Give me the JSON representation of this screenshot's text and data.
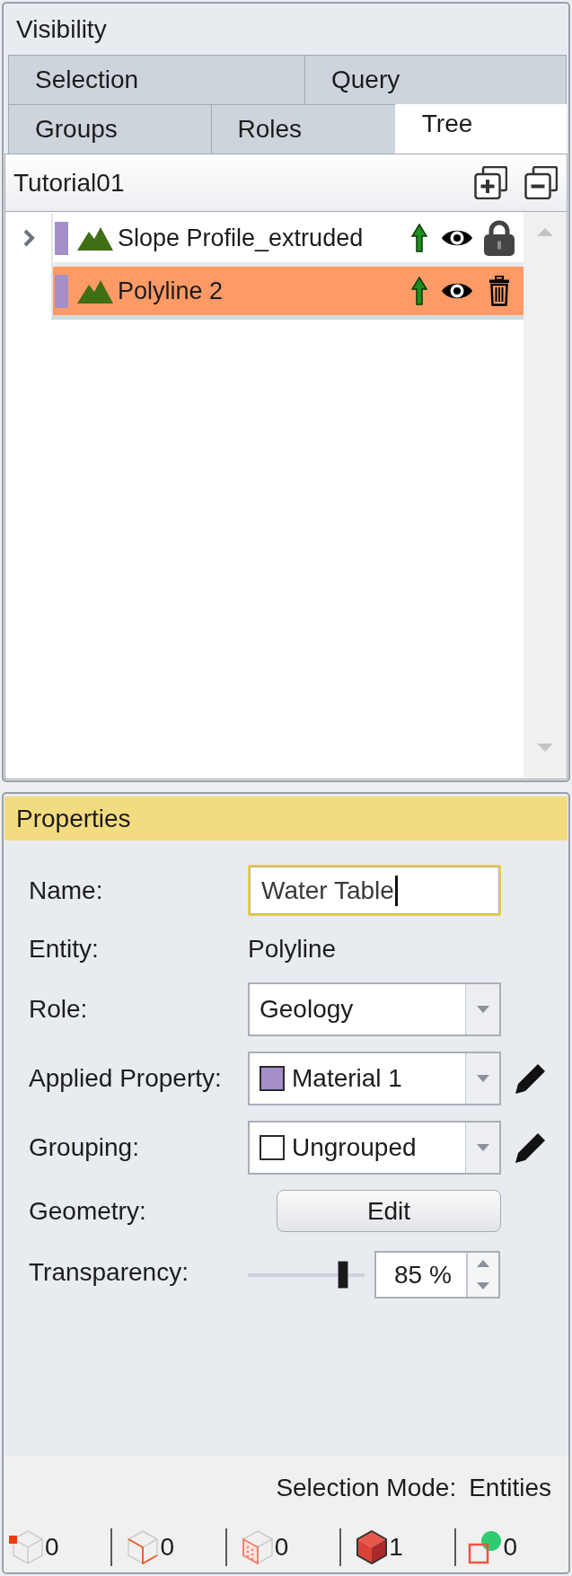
{
  "visibility_panel": {
    "title": "Visibility",
    "tab_rows": [
      {
        "tabs": [
          {
            "label": "Selection",
            "selected": false
          },
          {
            "label": "Query",
            "selected": false
          }
        ]
      },
      {
        "tabs": [
          {
            "label": "Groups",
            "selected": false
          },
          {
            "label": "Roles",
            "selected": false
          },
          {
            "label": "Tree",
            "selected": true
          }
        ]
      }
    ],
    "tree": {
      "root": "Tutorial01",
      "items": [
        {
          "label": "Slope Profile_extruded",
          "color": "#a48fc8",
          "expanded": false,
          "selected": false,
          "visible": true,
          "locked": true
        },
        {
          "label": "Polyline 2",
          "color": "#a48fc8",
          "selected": true,
          "visible": true,
          "locked": false
        }
      ]
    }
  },
  "properties_panel": {
    "title": "Properties",
    "fields": [
      {
        "kind": "text_input",
        "label": "Name:",
        "value": "Water Table",
        "focused": true
      },
      {
        "kind": "text",
        "label": "Entity:",
        "value": "Polyline"
      },
      {
        "kind": "dropdown",
        "label": "Role:",
        "value": "Geology"
      },
      {
        "kind": "dropdown",
        "label": "Applied Property:",
        "value": "Material 1",
        "color": "#a48fc8",
        "editable": true
      },
      {
        "kind": "dropdown",
        "label": "Grouping:",
        "value": "Ungrouped",
        "color": "#ffffff",
        "editable": true
      },
      {
        "kind": "button",
        "label": "Geometry:",
        "value": "Edit"
      },
      {
        "kind": "slider",
        "label": "Transparency:",
        "level": 0.85,
        "value": "85 %"
      }
    ]
  },
  "status_bar": {
    "selection_mode_label": "Selection Mode:",
    "selection_mode": "Entities",
    "counters": [
      {
        "kind": "vertex",
        "count": "0"
      },
      {
        "kind": "edge",
        "count": "0"
      },
      {
        "kind": "face",
        "count": "0"
      },
      {
        "kind": "solid",
        "count": "1"
      },
      {
        "kind": "group",
        "count": "0"
      }
    ]
  }
}
